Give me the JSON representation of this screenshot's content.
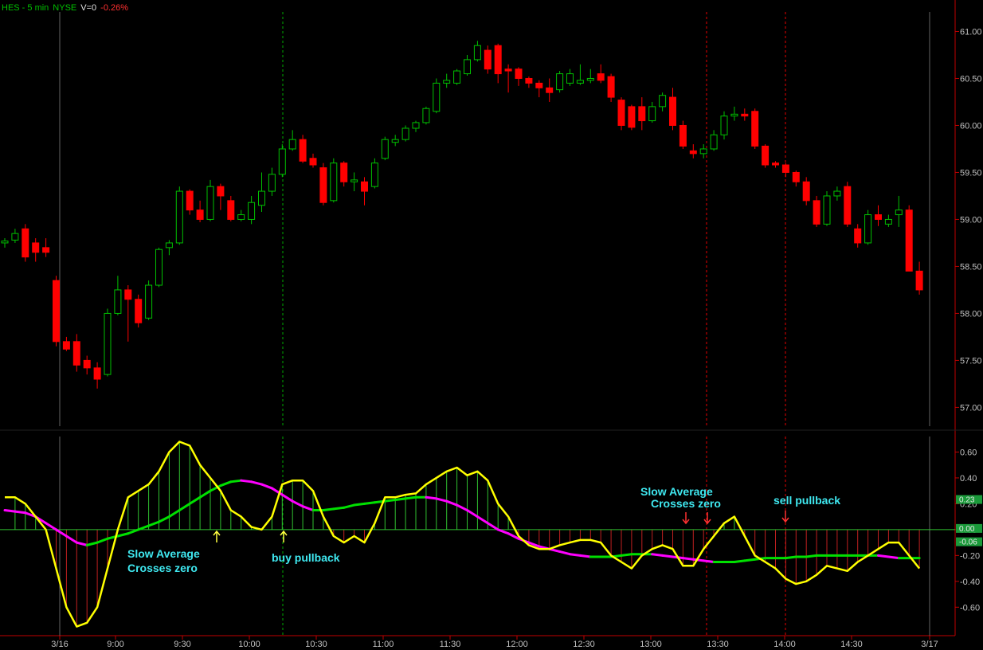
{
  "header": {
    "symbol": "HES - 5 min",
    "exchange": "NYSE",
    "volume": "V=0",
    "change": "-0.26%"
  },
  "colors": {
    "up_candle": "#00c000",
    "down_candle": "#ff0000",
    "oscillator": "#ffff00",
    "slow_avg_up": "#00e000",
    "slow_avg_down": "#ff00ff",
    "annotation": "#3fe8f0",
    "axis": "#c00000",
    "session_marker_buy": "#00c000",
    "session_marker_sell": "#ff0000"
  },
  "chart_data": [
    {
      "type": "candlestick",
      "name": "price",
      "ylim": [
        56.8,
        61.25
      ],
      "y_ticks": [
        "61.00",
        "60.50",
        "60.00",
        "59.50",
        "59.00",
        "58.50",
        "58.00",
        "57.50",
        "57.00"
      ],
      "x_ticks": [
        "3/16",
        "9:00",
        "9:30",
        "10:00",
        "10:30",
        "11:00",
        "11:30",
        "12:00",
        "12:30",
        "13:00",
        "13:30",
        "14:00",
        "14:30",
        "3/17"
      ],
      "candles": [
        [
          58.75,
          58.8,
          58.7,
          58.77
        ],
        [
          58.78,
          58.9,
          58.75,
          58.85
        ],
        [
          58.9,
          58.95,
          58.55,
          58.6
        ],
        [
          58.75,
          58.8,
          58.55,
          58.65
        ],
        [
          58.7,
          58.8,
          58.6,
          58.65
        ],
        [
          58.35,
          58.4,
          57.65,
          57.7
        ],
        [
          57.7,
          57.75,
          57.6,
          57.62
        ],
        [
          57.7,
          57.78,
          57.38,
          57.45
        ],
        [
          57.5,
          57.55,
          57.35,
          57.42
        ],
        [
          57.42,
          57.48,
          57.2,
          57.3
        ],
        [
          57.35,
          58.05,
          57.33,
          58.0
        ],
        [
          58.0,
          58.4,
          57.98,
          58.25
        ],
        [
          58.25,
          58.3,
          57.7,
          58.15
        ],
        [
          58.15,
          58.2,
          57.85,
          57.9
        ],
        [
          57.95,
          58.35,
          57.93,
          58.3
        ],
        [
          58.3,
          58.7,
          58.28,
          58.68
        ],
        [
          58.7,
          58.78,
          58.62,
          58.75
        ],
        [
          58.75,
          59.35,
          58.73,
          59.3
        ],
        [
          59.3,
          59.32,
          59.05,
          59.1
        ],
        [
          59.1,
          59.2,
          58.97,
          59.0
        ],
        [
          59.0,
          59.42,
          58.98,
          59.35
        ],
        [
          59.35,
          59.38,
          59.1,
          59.25
        ],
        [
          59.2,
          59.25,
          58.98,
          59.0
        ],
        [
          59.0,
          59.1,
          58.98,
          59.05
        ],
        [
          59.0,
          59.25,
          58.95,
          59.18
        ],
        [
          59.15,
          59.5,
          59.08,
          59.3
        ],
        [
          59.3,
          59.55,
          59.25,
          59.48
        ],
        [
          59.48,
          59.8,
          59.45,
          59.75
        ],
        [
          59.75,
          59.95,
          59.73,
          59.85
        ],
        [
          59.85,
          59.9,
          59.6,
          59.62
        ],
        [
          59.65,
          59.7,
          59.55,
          59.58
        ],
        [
          59.55,
          59.6,
          59.15,
          59.18
        ],
        [
          59.2,
          59.65,
          59.18,
          59.6
        ],
        [
          59.6,
          59.62,
          59.35,
          59.4
        ],
        [
          59.4,
          59.5,
          59.3,
          59.42
        ],
        [
          59.4,
          59.45,
          59.15,
          59.3
        ],
        [
          59.35,
          59.65,
          59.33,
          59.6
        ],
        [
          59.65,
          59.88,
          59.63,
          59.85
        ],
        [
          59.82,
          59.9,
          59.78,
          59.85
        ],
        [
          59.85,
          60.0,
          59.83,
          59.97
        ],
        [
          59.97,
          60.05,
          59.93,
          60.03
        ],
        [
          60.03,
          60.2,
          60.01,
          60.18
        ],
        [
          60.15,
          60.5,
          60.13,
          60.45
        ],
        [
          60.45,
          60.55,
          60.4,
          60.48
        ],
        [
          60.45,
          60.6,
          60.43,
          60.58
        ],
        [
          60.55,
          60.75,
          60.53,
          60.7
        ],
        [
          60.7,
          60.9,
          60.68,
          60.85
        ],
        [
          60.8,
          60.85,
          60.55,
          60.6
        ],
        [
          60.85,
          60.87,
          60.45,
          60.55
        ],
        [
          60.6,
          60.65,
          60.35,
          60.58
        ],
        [
          60.6,
          60.62,
          60.42,
          60.5
        ],
        [
          60.5,
          60.52,
          60.4,
          60.45
        ],
        [
          60.45,
          60.48,
          60.3,
          60.4
        ],
        [
          60.4,
          60.5,
          60.25,
          60.35
        ],
        [
          60.38,
          60.58,
          60.35,
          60.55
        ],
        [
          60.45,
          60.6,
          60.42,
          60.55
        ],
        [
          60.45,
          60.65,
          60.43,
          60.48
        ],
        [
          60.48,
          60.6,
          60.45,
          60.5
        ],
        [
          60.55,
          60.65,
          60.45,
          60.48
        ],
        [
          60.52,
          60.55,
          60.25,
          60.3
        ],
        [
          60.27,
          60.3,
          59.95,
          60.0
        ],
        [
          60.2,
          60.22,
          59.95,
          59.98
        ],
        [
          60.2,
          60.3,
          59.95,
          60.05
        ],
        [
          60.05,
          60.25,
          60.03,
          60.2
        ],
        [
          60.2,
          60.35,
          60.15,
          60.32
        ],
        [
          60.3,
          60.4,
          59.95,
          60.0
        ],
        [
          60.0,
          60.05,
          59.75,
          59.78
        ],
        [
          59.73,
          59.8,
          59.65,
          59.7
        ],
        [
          59.7,
          59.8,
          59.65,
          59.75
        ],
        [
          59.75,
          59.95,
          59.73,
          59.9
        ],
        [
          59.9,
          60.15,
          59.85,
          60.1
        ],
        [
          60.1,
          60.2,
          60.05,
          60.12
        ],
        [
          60.12,
          60.18,
          60.05,
          60.1
        ],
        [
          60.15,
          60.18,
          59.75,
          59.78
        ],
        [
          59.78,
          59.8,
          59.55,
          59.58
        ],
        [
          59.6,
          59.62,
          59.55,
          59.58
        ],
        [
          59.58,
          59.6,
          59.45,
          59.5
        ],
        [
          59.5,
          59.52,
          59.35,
          59.4
        ],
        [
          59.4,
          59.45,
          59.15,
          59.2
        ],
        [
          59.2,
          59.25,
          58.92,
          58.95
        ],
        [
          58.95,
          59.3,
          58.93,
          59.25
        ],
        [
          59.25,
          59.35,
          59.2,
          59.3
        ],
        [
          59.35,
          59.4,
          58.92,
          58.95
        ],
        [
          58.9,
          58.95,
          58.7,
          58.75
        ],
        [
          58.75,
          59.1,
          58.73,
          59.05
        ],
        [
          59.05,
          59.15,
          58.93,
          59.0
        ],
        [
          58.95,
          59.05,
          58.92,
          59.0
        ],
        [
          59.05,
          59.25,
          58.92,
          59.1
        ],
        [
          59.1,
          59.15,
          58.5,
          58.45
        ],
        [
          58.45,
          58.55,
          58.2,
          58.25
        ]
      ]
    },
    {
      "type": "line",
      "name": "oscillator",
      "ylim": [
        -0.82,
        0.72
      ],
      "y_ticks": [
        "0.60",
        "0.40",
        "0.20",
        "0.00",
        "-0.20",
        "-0.40",
        "-0.60"
      ],
      "badges": [
        {
          "text": "0.23",
          "color": "#1a9a3a",
          "value": 0.23
        },
        {
          "text": "0.00",
          "color": "#1a9a3a",
          "value": 0.0
        },
        {
          "text": "-0.06",
          "color": "#1a9a3a",
          "value": -0.06
        }
      ],
      "series": [
        {
          "values": [
            0.25,
            0.25,
            0.2,
            0.1,
            0.0,
            -0.3,
            -0.6,
            -0.75,
            -0.72,
            -0.6,
            -0.3,
            0.0,
            0.25,
            0.3,
            0.35,
            0.45,
            0.6,
            0.68,
            0.65,
            0.5,
            0.4,
            0.3,
            0.15,
            0.1,
            0.02,
            0.0,
            0.1,
            0.35,
            0.38,
            0.38,
            0.3,
            0.1,
            -0.05,
            -0.1,
            -0.05,
            -0.1,
            0.05,
            0.25,
            0.25,
            0.27,
            0.28,
            0.35,
            0.4,
            0.45,
            0.48,
            0.42,
            0.45,
            0.38,
            0.2,
            0.1,
            -0.05,
            -0.12,
            -0.15,
            -0.15,
            -0.12,
            -0.1,
            -0.08,
            -0.08,
            -0.1,
            -0.2,
            -0.25,
            -0.3,
            -0.2,
            -0.15,
            -0.12,
            -0.15,
            -0.28,
            -0.28,
            -0.15,
            -0.05,
            0.05,
            0.1,
            -0.05,
            -0.2,
            -0.25,
            -0.3,
            -0.38,
            -0.42,
            -0.4,
            -0.35,
            -0.28,
            -0.3,
            -0.32,
            -0.25,
            -0.2,
            -0.15,
            -0.1,
            -0.1,
            -0.2,
            -0.3
          ]
        },
        {
          "values": [
            0.15,
            0.14,
            0.13,
            0.1,
            0.05,
            0.0,
            -0.05,
            -0.1,
            -0.12,
            -0.1,
            -0.07,
            -0.05,
            -0.03,
            0.0,
            0.03,
            0.06,
            0.1,
            0.15,
            0.2,
            0.25,
            0.3,
            0.34,
            0.37,
            0.38,
            0.37,
            0.35,
            0.32,
            0.27,
            0.22,
            0.18,
            0.15,
            0.15,
            0.16,
            0.17,
            0.19,
            0.2,
            0.21,
            0.22,
            0.23,
            0.24,
            0.25,
            0.25,
            0.24,
            0.22,
            0.19,
            0.15,
            0.1,
            0.05,
            0.0,
            -0.03,
            -0.07,
            -0.1,
            -0.13,
            -0.15,
            -0.17,
            -0.19,
            -0.2,
            -0.21,
            -0.21,
            -0.21,
            -0.2,
            -0.19,
            -0.19,
            -0.19,
            -0.2,
            -0.21,
            -0.22,
            -0.23,
            -0.24,
            -0.25,
            -0.25,
            -0.25,
            -0.24,
            -0.23,
            -0.22,
            -0.22,
            -0.22,
            -0.21,
            -0.21,
            -0.2,
            -0.2,
            -0.2,
            -0.2,
            -0.2,
            -0.2,
            -0.2,
            -0.21,
            -0.22,
            -0.22,
            -0.22
          ]
        }
      ]
    }
  ],
  "annotations": [
    {
      "lines": [
        "Slow Average",
        "Crosses zero"
      ]
    },
    {
      "lines": [
        "buy pullback"
      ]
    },
    {
      "lines": [
        "Slow Average",
        "Crosses zero"
      ]
    },
    {
      "lines": [
        "sell pullback"
      ]
    }
  ]
}
